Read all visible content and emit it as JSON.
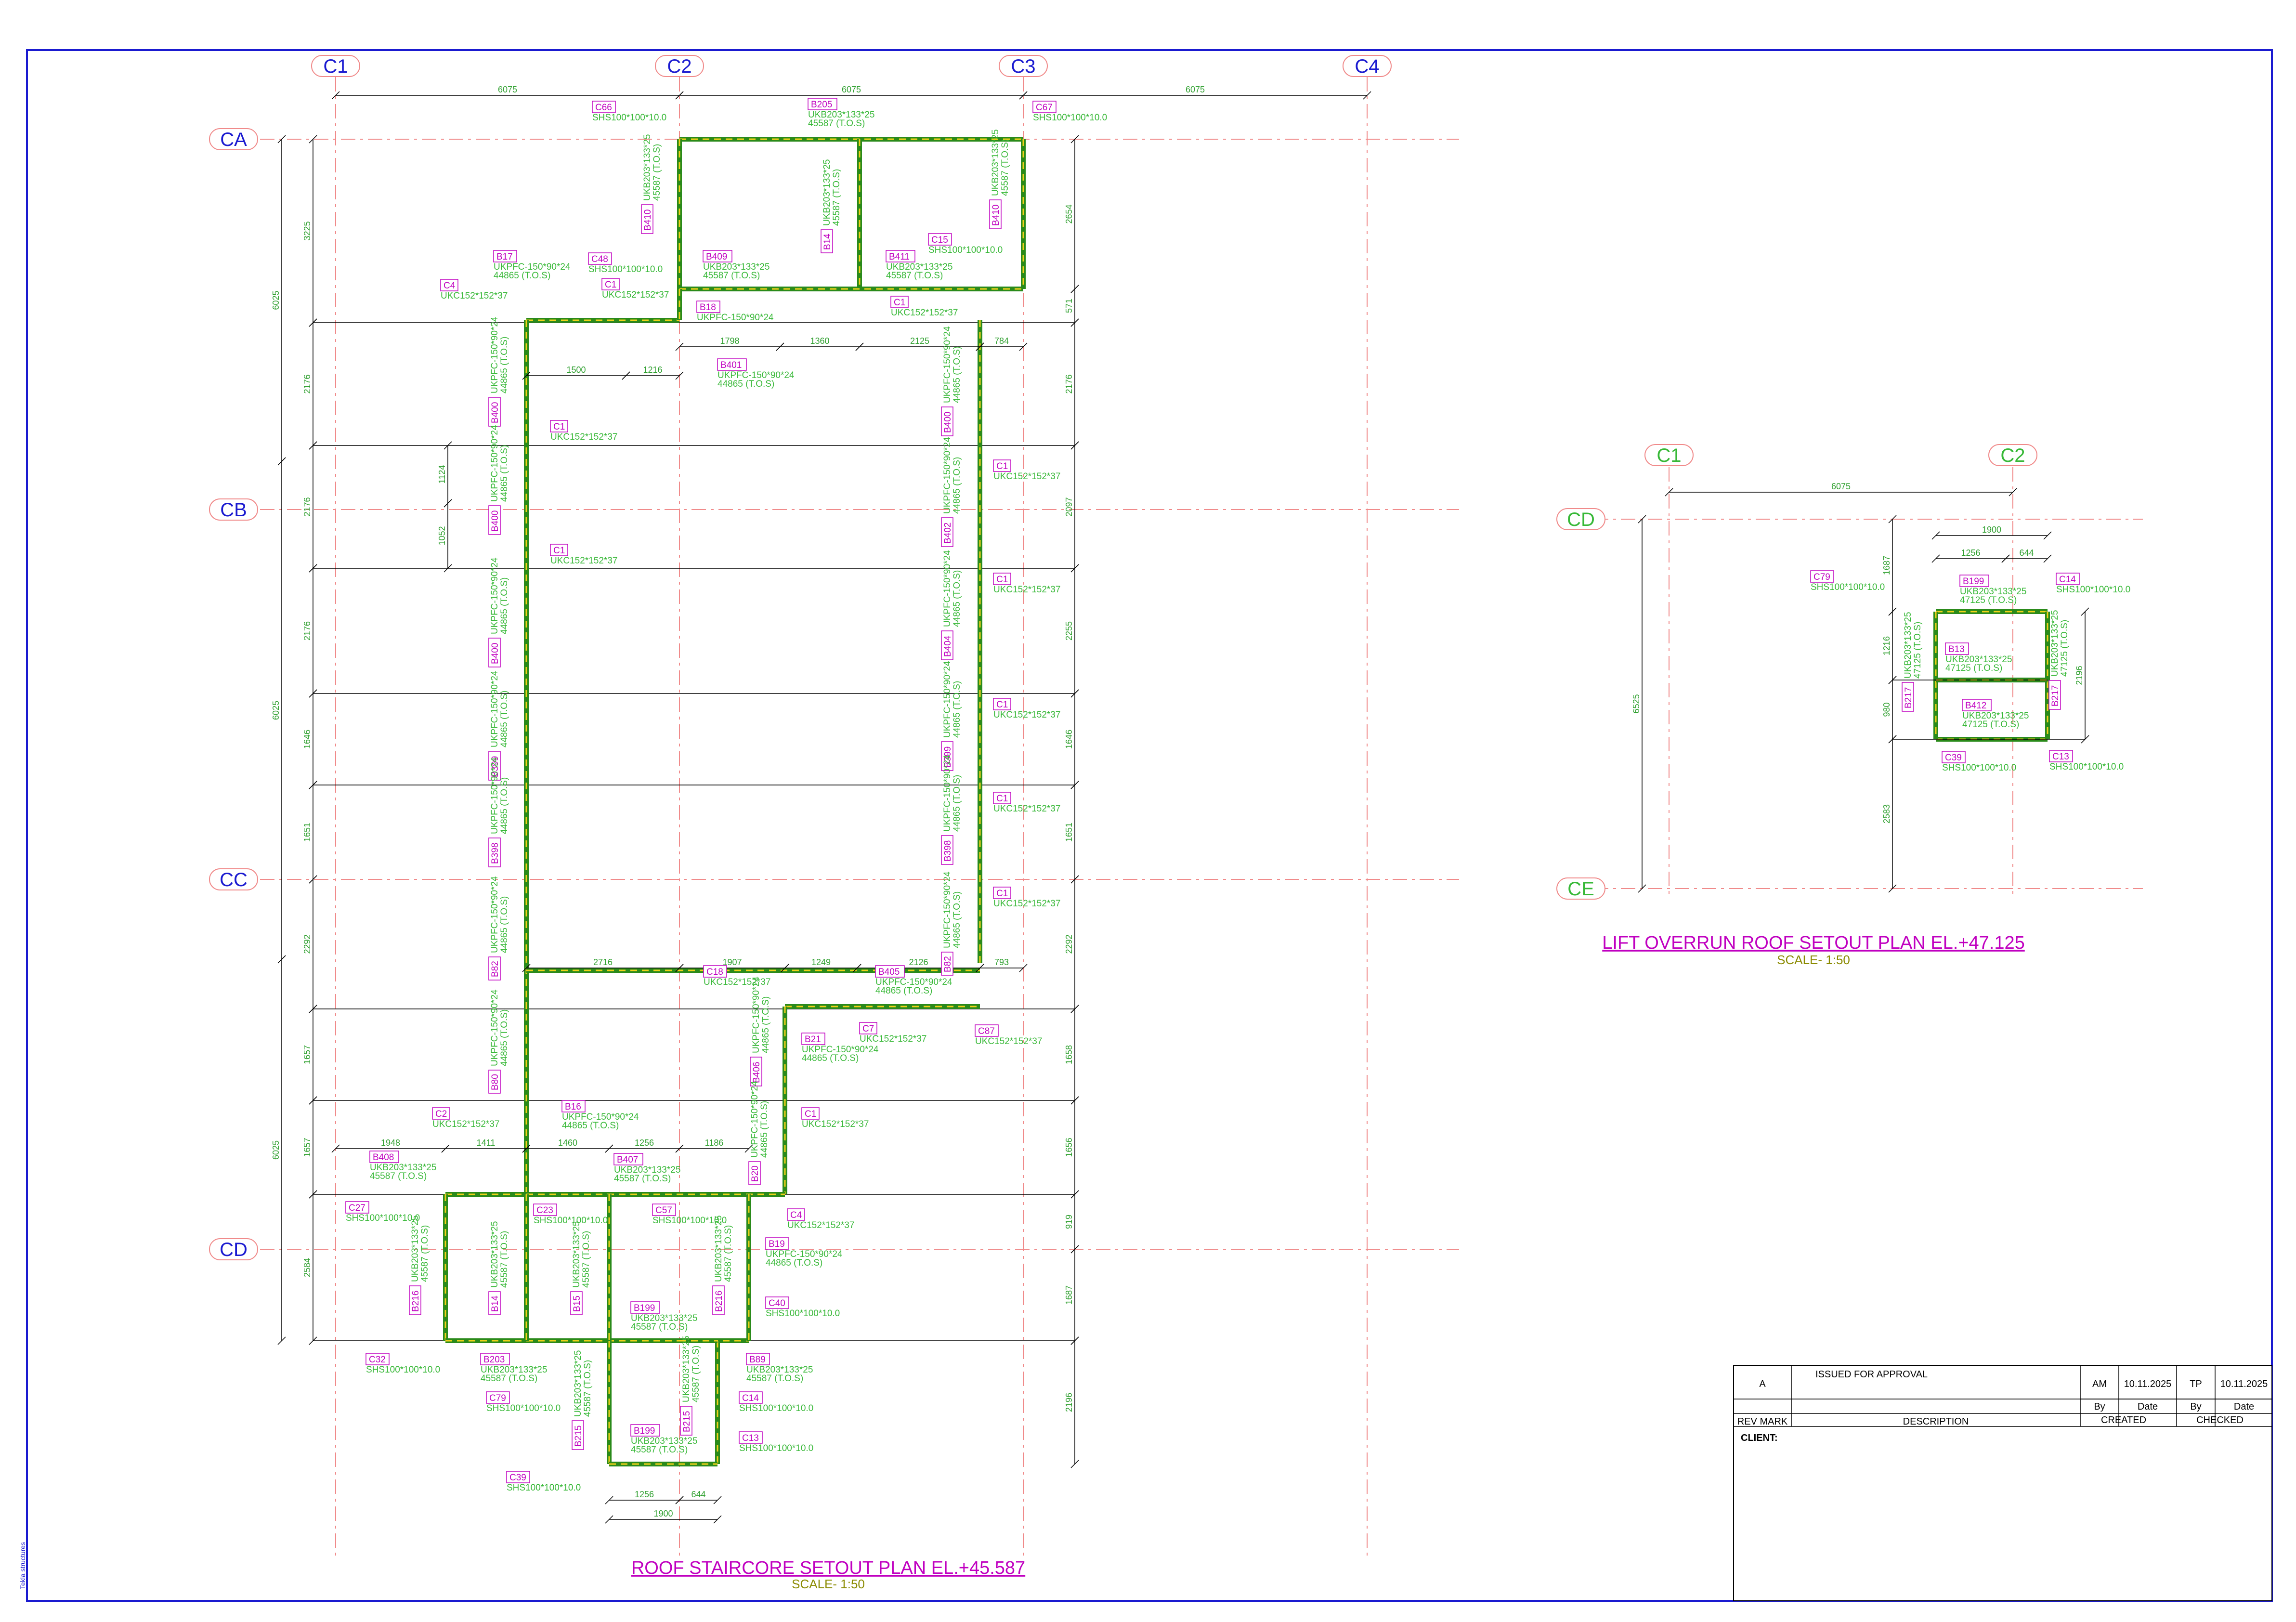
{
  "colors": {
    "frame": "#1a1ad0",
    "grid_line": "#f08a8a",
    "grid_bubble_text": "#1a1ad0",
    "grid_bubble_green": "#37b837",
    "member": "#2a8a1a",
    "member_dash": "#f0d21a",
    "dim": "#2e9f2e",
    "tag": "#c000c0",
    "title": "#c000c0",
    "scale": "#8a8a00",
    "structure": "#000000"
  },
  "plan1": {
    "title": "ROOF STAIRCORE SETOUT PLAN EL.+45.587",
    "scale": "SCALE- 1:50",
    "grid_cols": [
      "C1",
      "C2",
      "C3",
      "C4"
    ],
    "grid_rows": [
      "CA",
      "CB",
      "CC",
      "CD"
    ],
    "top_dims": [
      "6075",
      "6075",
      "6075"
    ],
    "left_dims_major": [
      "6025",
      "6025",
      "6025"
    ],
    "left_dims_minor": [
      "3225",
      "2176",
      "2176",
      "2176",
      "1646",
      "1651",
      "2292",
      "1657",
      "1657",
      "2584"
    ],
    "right_dims": [
      "2654",
      "571",
      "2176",
      "2097",
      "2255",
      "1646",
      "1651",
      "2292",
      "1658",
      "1656",
      "919",
      "1687",
      "2196"
    ],
    "inner_dims": [
      "1500",
      "1216",
      "1798",
      "1360",
      "2125",
      "784",
      "1124",
      "1052",
      "2716",
      "1907",
      "1249",
      "2126",
      "793",
      "1948",
      "1411",
      "1460",
      "1256",
      "1186",
      "1256",
      "644",
      "1900"
    ],
    "labels": [
      {
        "tag": "C66",
        "sec": "SHS100*100*10.0"
      },
      {
        "tag": "B205",
        "sec": "UKB203*133*25",
        "sec2": "45587 (T.O.S)"
      },
      {
        "tag": "C67",
        "sec": "SHS100*100*10.0"
      },
      {
        "tag": "B17",
        "sec": "UKPFC-150*90*24",
        "sec2": "44865 (T.O.S)"
      },
      {
        "tag": "C48",
        "sec": "SHS100*100*10.0"
      },
      {
        "tag": "B409",
        "sec": "UKB203*133*25",
        "sec2": "45587 (T.O.S)"
      },
      {
        "tag": "B411",
        "sec": "UKB203*133*25",
        "sec2": "45587 (T.O.S)"
      },
      {
        "tag": "C15",
        "sec": "SHS100*100*10.0"
      },
      {
        "tag": "C4",
        "sec": "UKC152*152*37"
      },
      {
        "tag": "C1",
        "sec": "UKC152*152*37"
      },
      {
        "tag": "B18",
        "sec": "UKPFC-150*90*24"
      },
      {
        "tag": "C1",
        "sec": "UKC152*152*37"
      },
      {
        "tag": "B401",
        "sec": "UKPFC-150*90*24",
        "sec2": "44865 (T.O.S)"
      },
      {
        "tag": "C1",
        "sec": "UKC152*152*37"
      },
      {
        "tag": "C1",
        "sec": "UKC152*152*37"
      },
      {
        "tag": "C1",
        "sec": "UKC152*152*37"
      },
      {
        "tag": "C1",
        "sec": "UKC152*152*37"
      },
      {
        "tag": "C1",
        "sec": "UKC152*152*37"
      },
      {
        "tag": "C1",
        "sec": "UKC152*152*37"
      },
      {
        "tag": "C1",
        "sec": "UKC152*152*37"
      },
      {
        "tag": "C18",
        "sec": "UKC152*152*37"
      },
      {
        "tag": "B405",
        "sec": "UKPFC-150*90*24",
        "sec2": "44865 (T.O.S)"
      },
      {
        "tag": "C7",
        "sec": "UKC152*152*37"
      },
      {
        "tag": "C87",
        "sec": "UKC152*152*37"
      },
      {
        "tag": "B21",
        "sec": "UKPFC-150*90*24",
        "sec2": "44865 (T.O.S)"
      },
      {
        "tag": "C1",
        "sec": "UKC152*152*37"
      },
      {
        "tag": "C2",
        "sec": "UKC152*152*37"
      },
      {
        "tag": "B16",
        "sec": "UKPFC-150*90*24",
        "sec2": "44865 (T.O.S)"
      },
      {
        "tag": "B408",
        "sec": "UKB203*133*25",
        "sec2": "45587 (T.O.S)"
      },
      {
        "tag": "B407",
        "sec": "UKB203*133*25",
        "sec2": "45587 (T.O.S)"
      },
      {
        "tag": "C27",
        "sec": "SHS100*100*10.0"
      },
      {
        "tag": "C23",
        "sec": "SHS100*100*10.0"
      },
      {
        "tag": "C57",
        "sec": "SHS100*100*10.0"
      },
      {
        "tag": "C4",
        "sec": "UKC152*152*37"
      },
      {
        "tag": "B19",
        "sec": "UKPFC-150*90*24",
        "sec2": "44865 (T.O.S)"
      },
      {
        "tag": "C40",
        "sec": "SHS100*100*10.0"
      },
      {
        "tag": "B199",
        "sec": "UKB203*133*25",
        "sec2": "45587 (T.O.S)"
      },
      {
        "tag": "C32",
        "sec": "SHS100*100*10.0"
      },
      {
        "tag": "B203",
        "sec": "UKB203*133*25",
        "sec2": "45587 (T.O.S)"
      },
      {
        "tag": "B89",
        "sec": "UKB203*133*25",
        "sec2": "45587 (T.O.S)"
      },
      {
        "tag": "C79",
        "sec": "SHS100*100*10.0"
      },
      {
        "tag": "C14",
        "sec": "SHS100*100*10.0"
      },
      {
        "tag": "B199",
        "sec": "UKB203*133*25",
        "sec2": "45587 (T.O.S)"
      },
      {
        "tag": "C13",
        "sec": "SHS100*100*10.0"
      },
      {
        "tag": "C39",
        "sec": "SHS100*100*10.0"
      }
    ],
    "vlabels": [
      {
        "tag": "B410",
        "sec": "UKB203*133*25",
        "sec2": "45587 (T.O.S)"
      },
      {
        "tag": "B14",
        "sec": "UKB203*133*25",
        "sec2": "45587 (T.O.S)"
      },
      {
        "tag": "B410",
        "sec": "UKB203*133*25",
        "sec2": "45587 (T.O.S)"
      },
      {
        "tag": "B400",
        "sec": "UKPFC-150*90*24",
        "sec2": "44865 (T.O.S)"
      },
      {
        "tag": "B400",
        "sec": "UKPFC-150*90*24",
        "sec2": "44865 (T.O.S)"
      },
      {
        "tag": "B400",
        "sec": "UKPFC-150*90*24",
        "sec2": "44865 (T.O.S)"
      },
      {
        "tag": "B399",
        "sec": "UKPFC-150*90*24",
        "sec2": "44865 (T.O.S)"
      },
      {
        "tag": "B398",
        "sec": "UKPFC-150*90*24",
        "sec2": "44865 (T.O.S)"
      },
      {
        "tag": "B82",
        "sec": "UKPFC-150*90*24",
        "sec2": "44865 (T.O.S)"
      },
      {
        "tag": "B80",
        "sec": "UKPFC-150*90*24",
        "sec2": "44865 (T.O.S)"
      },
      {
        "tag": "B400",
        "sec": "UKPFC-150*90*24",
        "sec2": "44865 (T.O.S)"
      },
      {
        "tag": "B402",
        "sec": "UKPFC-150*90*24",
        "sec2": "44865 (T.O.S)"
      },
      {
        "tag": "B404",
        "sec": "UKPFC-150*90*24",
        "sec2": "44865 (T.O.S)"
      },
      {
        "tag": "B399",
        "sec": "UKPFC-150*90*24",
        "sec2": "44865 (T.O.S)"
      },
      {
        "tag": "B398",
        "sec": "UKPFC-150*90*24",
        "sec2": "44865 (T.O.S)"
      },
      {
        "tag": "B82",
        "sec": "UKPFC-150*90*24",
        "sec2": "44865 (T.O.S)"
      },
      {
        "tag": "B406",
        "sec": "UKPFC-150*90*24",
        "sec2": "44865 (T.O.S)"
      },
      {
        "tag": "B20",
        "sec": "UKPFC-150*90*24",
        "sec2": "44865 (T.O.S)"
      },
      {
        "tag": "B216",
        "sec": "UKB203*133*25",
        "sec2": "45587 (T.O.S)"
      },
      {
        "tag": "B14",
        "sec": "UKB203*133*25",
        "sec2": "45587 (T.O.S)"
      },
      {
        "tag": "B15",
        "sec": "UKB203*133*25",
        "sec2": "45587 (T.O.S)"
      },
      {
        "tag": "B216",
        "sec": "UKB203*133*25",
        "sec2": "45587 (T.O.S)"
      },
      {
        "tag": "B215",
        "sec": "UKB203*133*25",
        "sec2": "45587 (T.O.S)"
      },
      {
        "tag": "B215",
        "sec": "UKB203*133*25",
        "sec2": "45587 (T.O.S)"
      }
    ]
  },
  "plan2": {
    "title": "LIFT OVERRUN ROOF SETOUT PLAN EL.+47.125",
    "scale": "SCALE- 1:50",
    "grid_cols": [
      "C1",
      "C2"
    ],
    "grid_rows": [
      "CD",
      "CE"
    ],
    "top_dim": "6075",
    "left_dim": "6525",
    "dims": [
      "1900",
      "1256",
      "644",
      "1687",
      "1216",
      "980",
      "2583",
      "2196"
    ],
    "labels": [
      {
        "tag": "C79",
        "sec": "SHS100*100*10.0"
      },
      {
        "tag": "B199",
        "sec": "UKB203*133*25",
        "sec2": "47125 (T.O.S)"
      },
      {
        "tag": "C14",
        "sec": "SHS100*100*10.0"
      },
      {
        "tag": "B13",
        "sec": "UKB203*133*25",
        "sec2": "47125 (T.O.S)"
      },
      {
        "tag": "B412",
        "sec": "UKB203*133*25",
        "sec2": "47125 (T.O.S)"
      },
      {
        "tag": "C39",
        "sec": "SHS100*100*10.0"
      },
      {
        "tag": "C13",
        "sec": "SHS100*100*10.0"
      }
    ],
    "vlabels": [
      {
        "tag": "B217",
        "sec": "UKB203*133*25",
        "sec2": "47125 (T.O.S)"
      },
      {
        "tag": "B217",
        "sec": "UKB203*133*25",
        "sec2": "47125 (T.O.S)"
      }
    ]
  },
  "title_block": {
    "rev": "A",
    "description": "ISSUED FOR APPROVAL",
    "created_by": "AM",
    "created_date": "10.11.2025",
    "checked_by": "TP",
    "checked_date": "10.11.2025",
    "by_label": "By",
    "date_label": "Date",
    "by_label2": "By",
    "date_label2": "Date",
    "rev_mark_label": "REV MARK",
    "description_label": "DESCRIPTION",
    "created_label": "CREATED",
    "checked_label": "CHECKED",
    "client_label": "CLIENT:"
  },
  "side_note": "Tekla structures"
}
